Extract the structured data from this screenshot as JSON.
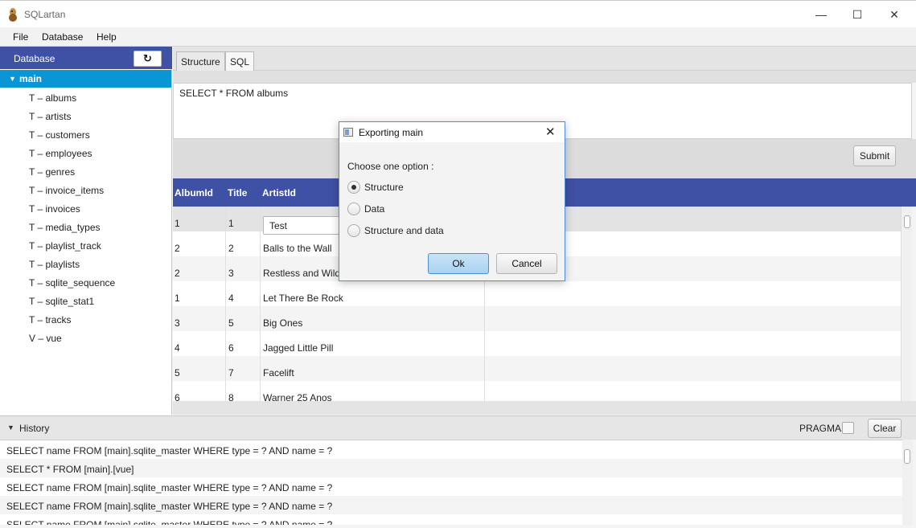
{
  "window": {
    "title": "SQLartan",
    "minimize_glyph": "—",
    "maximize_glyph": "☐",
    "close_glyph": "✕"
  },
  "menu": [
    "File",
    "Database",
    "Help"
  ],
  "sidebar": {
    "header": "Database",
    "refresh_glyph": "↻",
    "root": {
      "arrow": "▼",
      "label": "main"
    },
    "items": [
      "T – albums",
      "T – artists",
      "T – customers",
      "T – employees",
      "T – genres",
      "T – invoice_items",
      "T – invoices",
      "T – media_types",
      "T – playlist_track",
      "T – playlists",
      "T – sqlite_sequence",
      "T – sqlite_stat1",
      "T – tracks",
      "V – vue"
    ]
  },
  "tabs": [
    {
      "label": "Structure",
      "active": false
    },
    {
      "label": "SQL",
      "active": true
    }
  ],
  "sql": {
    "query": "SELECT * FROM albums",
    "submit_label": "Submit"
  },
  "results": {
    "columns": [
      "AlbumId",
      "Title",
      "ArtistId"
    ],
    "editing_value": "Test",
    "rows": [
      [
        "1",
        "1",
        "Test"
      ],
      [
        "2",
        "2",
        "Balls to the Wall"
      ],
      [
        "2",
        "3",
        "Restless and Wild"
      ],
      [
        "1",
        "4",
        "Let There Be Rock"
      ],
      [
        "3",
        "5",
        "Big Ones"
      ],
      [
        "4",
        "6",
        "Jagged Little Pill"
      ],
      [
        "5",
        "7",
        "Facelift"
      ],
      [
        "6",
        "8",
        "Warner 25 Anos"
      ]
    ]
  },
  "history": {
    "arrow": "▼",
    "title": "History",
    "pragma_label": "PRAGMA",
    "pragma_checked": false,
    "clear_label": "Clear",
    "entries": [
      "SELECT name FROM [main].sqlite_master WHERE type = ? AND name = ?",
      "SELECT * FROM [main].[vue]",
      "SELECT name FROM [main].sqlite_master WHERE type = ? AND name = ?",
      "SELECT name FROM [main].sqlite_master WHERE type = ? AND name = ?",
      "SELECT name FROM [main].sqlite_master WHERE type = ? AND name = ?"
    ]
  },
  "dialog": {
    "title": "Exporting main",
    "close_glyph": "✕",
    "prompt": "Choose one option :",
    "options": [
      {
        "label": "Structure",
        "checked": true
      },
      {
        "label": "Data",
        "checked": false
      },
      {
        "label": "Structure and data",
        "checked": false
      }
    ],
    "ok_label": "Ok",
    "cancel_label": "Cancel"
  },
  "colors": {
    "header_blue": "#3f51a5",
    "selection_blue": "#0a96d4",
    "dialog_border": "#4a8fd8"
  }
}
